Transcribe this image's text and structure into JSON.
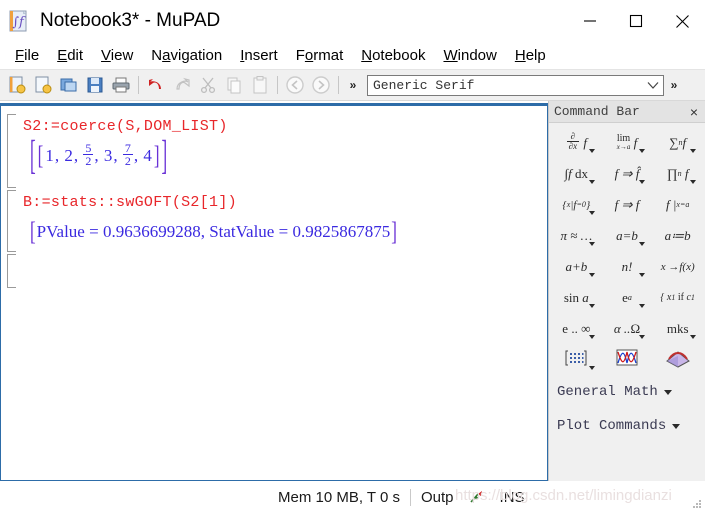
{
  "window": {
    "title": "Notebook3* - MuPAD",
    "app_icon": "mupad-document-icon",
    "controls": {
      "minimize": "minimize-button",
      "maximize": "maximize-button",
      "close": "close-button"
    }
  },
  "menubar": {
    "items": [
      {
        "label": "File",
        "mnemonic": "F"
      },
      {
        "label": "Edit",
        "mnemonic": "E"
      },
      {
        "label": "View",
        "mnemonic": "V"
      },
      {
        "label": "Navigation",
        "mnemonic": "a"
      },
      {
        "label": "Insert",
        "mnemonic": "I"
      },
      {
        "label": "Format",
        "mnemonic": "o"
      },
      {
        "label": "Notebook",
        "mnemonic": "N"
      },
      {
        "label": "Window",
        "mnemonic": "W"
      },
      {
        "label": "Help",
        "mnemonic": "H"
      }
    ]
  },
  "toolbar": {
    "buttons": [
      {
        "name": "new-notebook-icon",
        "enabled": true
      },
      {
        "name": "new-page-icon",
        "enabled": true
      },
      {
        "name": "open-icon",
        "enabled": true
      },
      {
        "name": "save-icon",
        "enabled": true
      },
      {
        "name": "print-icon",
        "enabled": true
      },
      {
        "name": "undo-icon",
        "enabled": true
      },
      {
        "name": "redo-icon",
        "enabled": false
      },
      {
        "name": "cut-icon",
        "enabled": false
      },
      {
        "name": "copy-icon",
        "enabled": false
      },
      {
        "name": "paste-icon",
        "enabled": false
      },
      {
        "name": "back-icon",
        "enabled": false
      },
      {
        "name": "forward-icon",
        "enabled": false
      }
    ],
    "overflow_label": "»",
    "font_select": {
      "value": "Generic Serif",
      "placeholder": "Generic Serif"
    },
    "font_overflow_label": "»"
  },
  "notebook": {
    "cells": [
      {
        "type": "input-output",
        "input": "S2:=coerce(S,DOM_LIST)",
        "output": {
          "open": "[[",
          "items": [
            {
              "kind": "int",
              "value": "1"
            },
            {
              "kind": "int",
              "value": "2"
            },
            {
              "kind": "frac",
              "num": "5",
              "den": "2"
            },
            {
              "kind": "int",
              "value": "3"
            },
            {
              "kind": "frac",
              "num": "7",
              "den": "2"
            },
            {
              "kind": "int",
              "value": "4"
            }
          ],
          "close": "]]"
        }
      },
      {
        "type": "input-output",
        "input": "B:=stats::swGOFT(S2[1])",
        "output_text": "[PValue = 0.9636699288, StatValue = 0.9825867875]",
        "output_fields": [
          {
            "label": "PValue",
            "value": "0.9636699288"
          },
          {
            "label": "StatValue",
            "value": "0.9825867875"
          }
        ]
      },
      {
        "type": "empty-input",
        "input": ""
      }
    ]
  },
  "commandbar": {
    "title": "Command Bar",
    "close_label": "×",
    "buttons": [
      {
        "name": "derivative-button",
        "glyph": "∂/∂x f",
        "caret": true
      },
      {
        "name": "limit-button",
        "glyph": "lim x→a f",
        "caret": true
      },
      {
        "name": "sum-button",
        "glyph": "∑ₙ f",
        "caret": true
      },
      {
        "name": "integral-button",
        "glyph": "∫f dx",
        "caret": true
      },
      {
        "name": "transform-button",
        "glyph": "f ⇒ f̂",
        "caret": true
      },
      {
        "name": "product-button",
        "glyph": "∏ₙ f",
        "caret": true
      },
      {
        "name": "solve-button",
        "glyph": "{x | f=0}",
        "caret": true
      },
      {
        "name": "simplify-button",
        "glyph": "f ⇒ f",
        "caret": false
      },
      {
        "name": "evaluate-at-button",
        "glyph": "f |x=a",
        "caret": false
      },
      {
        "name": "numeric-button",
        "glyph": "π ≈ …",
        "caret": true
      },
      {
        "name": "equation-button",
        "glyph": "a = b",
        "caret": true
      },
      {
        "name": "assign-button",
        "glyph": "a := b",
        "caret": false
      },
      {
        "name": "arithmetic-button",
        "glyph": "a+b",
        "caret": true
      },
      {
        "name": "factorial-button",
        "glyph": "n !",
        "caret": true
      },
      {
        "name": "function-button",
        "glyph": "x → f(x)",
        "caret": false
      },
      {
        "name": "trig-button",
        "glyph": "sin a",
        "caret": true
      },
      {
        "name": "exponential-button",
        "glyph": "eᵃ",
        "caret": true
      },
      {
        "name": "piecewise-button",
        "glyph": "{ x₁ if c₁",
        "caret": false
      },
      {
        "name": "constants-button",
        "glyph": "e .. ∞",
        "caret": true
      },
      {
        "name": "greek-button",
        "glyph": "α .. Ω",
        "caret": true
      },
      {
        "name": "units-button",
        "glyph": "mks",
        "caret": true
      },
      {
        "name": "matrix-button",
        "glyph": "matrix-icon",
        "caret": true
      },
      {
        "name": "plot-2d-button",
        "glyph": "plot-2d-icon",
        "caret": false
      },
      {
        "name": "plot-3d-button",
        "glyph": "plot-3d-icon",
        "caret": false
      }
    ],
    "dropdowns": [
      {
        "label": "General Math"
      },
      {
        "label": "Plot Commands"
      }
    ]
  },
  "statusbar": {
    "memory": "Mem 10 MB, T 0 s",
    "output_field": "Outp",
    "icon": "mupad-kernel-icon",
    "insert_mode": "INS"
  },
  "watermark": {
    "text": "https://blog.csdn.net/limingdianzi"
  },
  "colors": {
    "input_text": "#e8262a",
    "output_text": "#3b2ae0",
    "bracket": "#6a32d6",
    "notebook_border": "#2d6ca8",
    "panel_bg": "#f0f0f0"
  }
}
